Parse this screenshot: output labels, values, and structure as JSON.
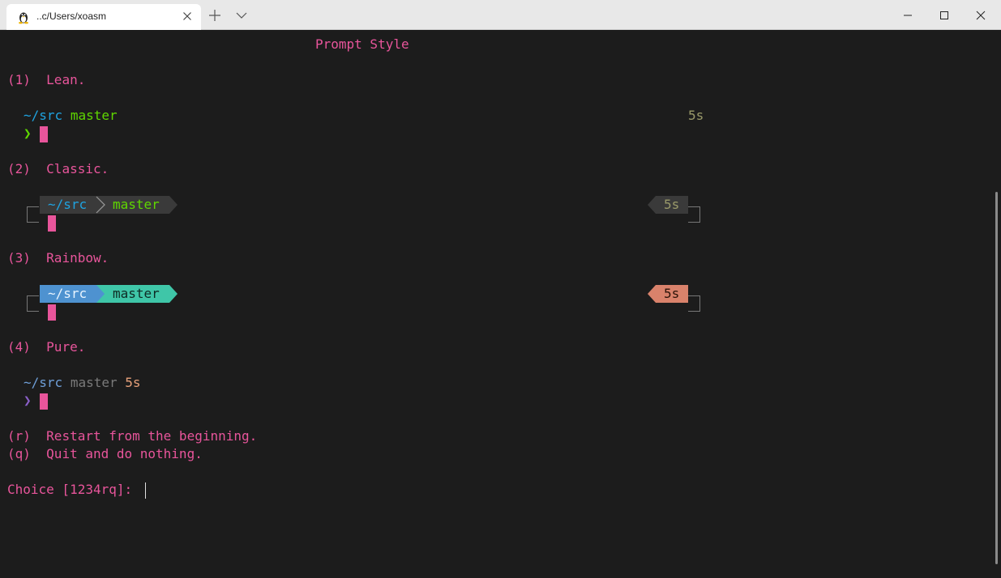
{
  "tab": {
    "title": "..c/Users/xoasm",
    "icon": "linux-tux-icon"
  },
  "terminal": {
    "header": "Prompt Style",
    "options": {
      "lean": {
        "key": "(1)",
        "label": "Lean."
      },
      "classic": {
        "key": "(2)",
        "label": "Classic."
      },
      "rainbow": {
        "key": "(3)",
        "label": "Rainbow."
      },
      "pure": {
        "key": "(4)",
        "label": "Pure."
      },
      "restart": {
        "key": "(r)",
        "label": "Restart from the beginning."
      },
      "quit": {
        "key": "(q)",
        "label": "Quit and do nothing."
      }
    },
    "preview": {
      "dir": "~/src",
      "branch": "master",
      "duration": "5s",
      "prompt_char": "❯"
    },
    "choice_prompt": "Choice [1234rq]: "
  },
  "colors": {
    "pink": "#e8559b",
    "blue": "#1fa3e0",
    "green": "#5fd700",
    "rainbow_blue": "#4e92d0",
    "rainbow_teal": "#3fc6a8",
    "rainbow_salmon": "#d9826b",
    "classic_segment": "#3a3a3a"
  }
}
